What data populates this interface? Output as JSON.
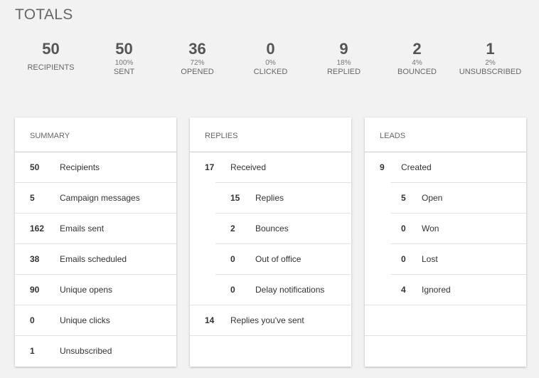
{
  "header": {
    "title": "TOTALS"
  },
  "stats": [
    {
      "value": "50",
      "percent": "",
      "label": "RECIPIENTS"
    },
    {
      "value": "50",
      "percent": "100%",
      "label": "SENT"
    },
    {
      "value": "36",
      "percent": "72%",
      "label": "OPENED"
    },
    {
      "value": "0",
      "percent": "0%",
      "label": "CLICKED"
    },
    {
      "value": "9",
      "percent": "18%",
      "label": "REPLIED"
    },
    {
      "value": "2",
      "percent": "4%",
      "label": "BOUNCED"
    },
    {
      "value": "1",
      "percent": "2%",
      "label": "UNSUBSCRIBED"
    }
  ],
  "summary": {
    "title": "SUMMARY",
    "rows": [
      {
        "value": "50",
        "label": "Recipients"
      },
      {
        "value": "5",
        "label": "Campaign messages"
      },
      {
        "value": "162",
        "label": "Emails sent"
      },
      {
        "value": "38",
        "label": "Emails scheduled"
      },
      {
        "value": "90",
        "label": "Unique opens"
      },
      {
        "value": "0",
        "label": "Unique clicks"
      },
      {
        "value": "1",
        "label": "Unsubscribed"
      }
    ]
  },
  "replies": {
    "title": "REPLIES",
    "received": {
      "value": "17",
      "label": "Received"
    },
    "breakdown": [
      {
        "value": "15",
        "label": "Replies"
      },
      {
        "value": "2",
        "label": "Bounces"
      },
      {
        "value": "0",
        "label": "Out of office"
      },
      {
        "value": "0",
        "label": "Delay notifications"
      }
    ],
    "sent": {
      "value": "14",
      "label": "Replies you've sent"
    }
  },
  "leads": {
    "title": "LEADS",
    "created": {
      "value": "9",
      "label": "Created"
    },
    "breakdown": [
      {
        "value": "5",
        "label": "Open"
      },
      {
        "value": "0",
        "label": "Won"
      },
      {
        "value": "0",
        "label": "Lost"
      },
      {
        "value": "4",
        "label": "Ignored"
      }
    ]
  }
}
